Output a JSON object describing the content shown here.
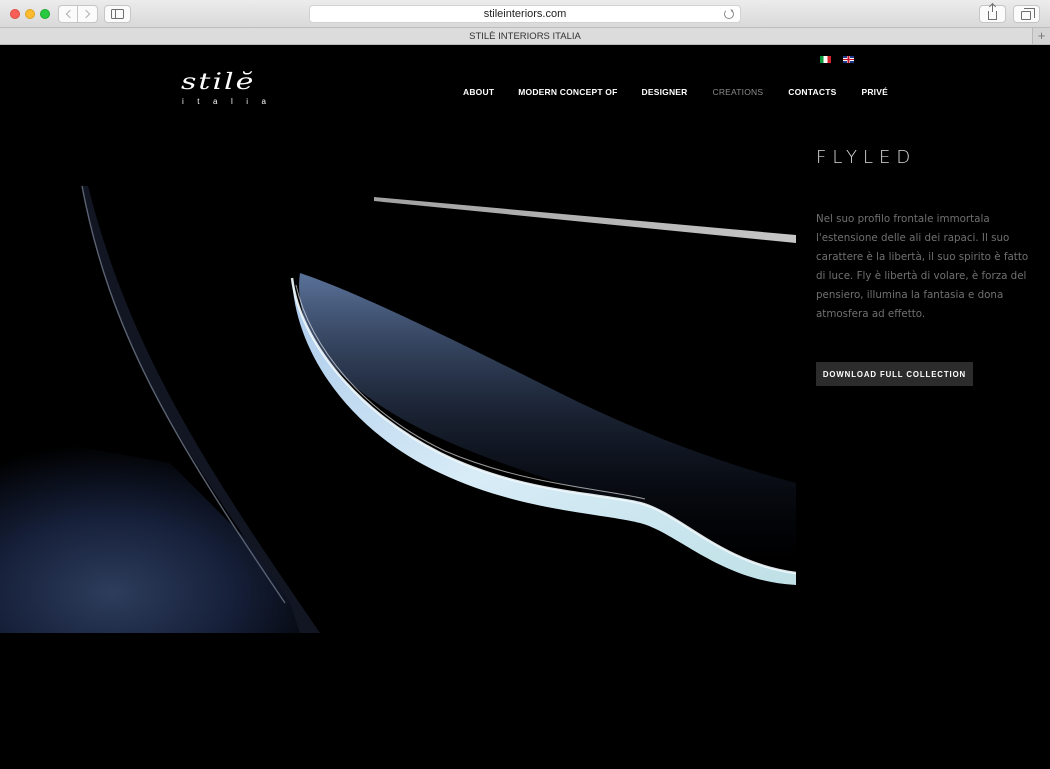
{
  "browser": {
    "url": "stileinteriors.com",
    "tab_title": "STILÈ INTERIORS ITALIA",
    "new_tab_symbol": "+"
  },
  "site": {
    "logo": {
      "word": "stilĕ",
      "sub": "italia"
    },
    "languages": [
      {
        "icon": "italian-flag-icon"
      },
      {
        "icon": "uk-flag-icon"
      }
    ],
    "nav": [
      {
        "label": "ABOUT"
      },
      {
        "label": "MODERN CONCEPT OF"
      },
      {
        "label": "DESIGNER"
      },
      {
        "label": "CREATIONS",
        "active": true
      },
      {
        "label": "CONTACTS"
      },
      {
        "label": "PRIVÉ"
      }
    ],
    "product": {
      "title": "FLYLED",
      "description": "Nel suo profilo frontale immortala l'estensione delle ali dei rapaci. Il suo carattere è la libertà, il suo spirito è fatto di luce. Fly è libertà di volare, è forza del pensiero, illumina la fantasia e dona atmosfera ad effetto.",
      "button": "DOWNLOAD FULL COLLECTION"
    }
  },
  "colors": {
    "background": "#000000",
    "nav_active": "#8c8c8c",
    "title": "#d9d9d9",
    "body_text": "#707070",
    "button_bg": "#2c2c2c",
    "glow": "#cfe4f4"
  }
}
